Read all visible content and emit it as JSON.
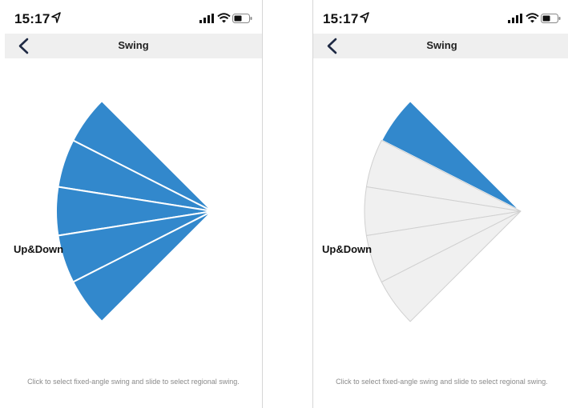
{
  "screens": [
    {
      "status_time": "15:17",
      "title": "Swing",
      "axis_label": "Up&Down",
      "hint": "Click to select fixed-angle swing and slide to select regional swing.",
      "selected_sectors": [
        1,
        2,
        3,
        4,
        5
      ]
    },
    {
      "status_time": "15:17",
      "title": "Swing",
      "axis_label": "Up&Down",
      "hint": "Click to select fixed-angle swing and slide to select regional swing.",
      "selected_sectors": [
        1
      ]
    }
  ],
  "colors": {
    "selected": "#3288cc",
    "unselected": "#f0f0f0",
    "unselected_stroke": "#d0d0d0",
    "navbar": "#efefef"
  },
  "icons": [
    "location-arrow-icon",
    "cellular-signal-icon",
    "wifi-icon",
    "battery-icon",
    "back-chevron-icon"
  ]
}
